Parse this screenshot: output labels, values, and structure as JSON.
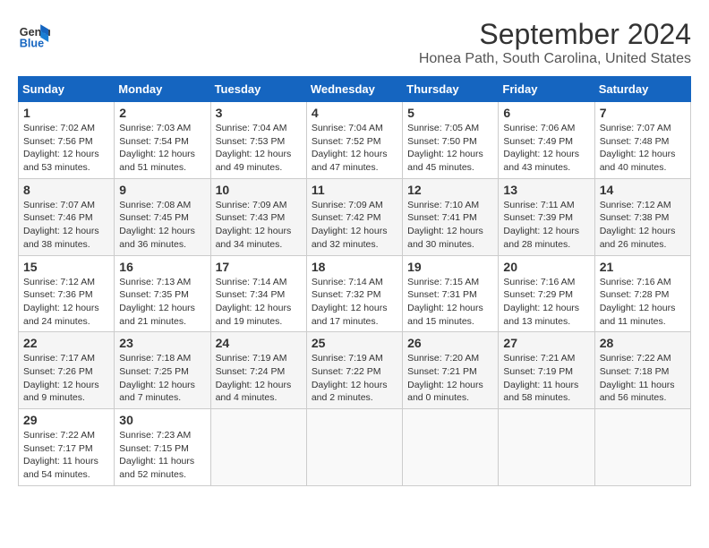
{
  "logo": {
    "line1": "General",
    "line2": "Blue"
  },
  "title": "September 2024",
  "subtitle": "Honea Path, South Carolina, United States",
  "weekdays": [
    "Sunday",
    "Monday",
    "Tuesday",
    "Wednesday",
    "Thursday",
    "Friday",
    "Saturday"
  ],
  "weeks": [
    [
      {
        "day": "1",
        "info": "Sunrise: 7:02 AM\nSunset: 7:56 PM\nDaylight: 12 hours\nand 53 minutes."
      },
      {
        "day": "2",
        "info": "Sunrise: 7:03 AM\nSunset: 7:54 PM\nDaylight: 12 hours\nand 51 minutes."
      },
      {
        "day": "3",
        "info": "Sunrise: 7:04 AM\nSunset: 7:53 PM\nDaylight: 12 hours\nand 49 minutes."
      },
      {
        "day": "4",
        "info": "Sunrise: 7:04 AM\nSunset: 7:52 PM\nDaylight: 12 hours\nand 47 minutes."
      },
      {
        "day": "5",
        "info": "Sunrise: 7:05 AM\nSunset: 7:50 PM\nDaylight: 12 hours\nand 45 minutes."
      },
      {
        "day": "6",
        "info": "Sunrise: 7:06 AM\nSunset: 7:49 PM\nDaylight: 12 hours\nand 43 minutes."
      },
      {
        "day": "7",
        "info": "Sunrise: 7:07 AM\nSunset: 7:48 PM\nDaylight: 12 hours\nand 40 minutes."
      }
    ],
    [
      {
        "day": "8",
        "info": "Sunrise: 7:07 AM\nSunset: 7:46 PM\nDaylight: 12 hours\nand 38 minutes."
      },
      {
        "day": "9",
        "info": "Sunrise: 7:08 AM\nSunset: 7:45 PM\nDaylight: 12 hours\nand 36 minutes."
      },
      {
        "day": "10",
        "info": "Sunrise: 7:09 AM\nSunset: 7:43 PM\nDaylight: 12 hours\nand 34 minutes."
      },
      {
        "day": "11",
        "info": "Sunrise: 7:09 AM\nSunset: 7:42 PM\nDaylight: 12 hours\nand 32 minutes."
      },
      {
        "day": "12",
        "info": "Sunrise: 7:10 AM\nSunset: 7:41 PM\nDaylight: 12 hours\nand 30 minutes."
      },
      {
        "day": "13",
        "info": "Sunrise: 7:11 AM\nSunset: 7:39 PM\nDaylight: 12 hours\nand 28 minutes."
      },
      {
        "day": "14",
        "info": "Sunrise: 7:12 AM\nSunset: 7:38 PM\nDaylight: 12 hours\nand 26 minutes."
      }
    ],
    [
      {
        "day": "15",
        "info": "Sunrise: 7:12 AM\nSunset: 7:36 PM\nDaylight: 12 hours\nand 24 minutes."
      },
      {
        "day": "16",
        "info": "Sunrise: 7:13 AM\nSunset: 7:35 PM\nDaylight: 12 hours\nand 21 minutes."
      },
      {
        "day": "17",
        "info": "Sunrise: 7:14 AM\nSunset: 7:34 PM\nDaylight: 12 hours\nand 19 minutes."
      },
      {
        "day": "18",
        "info": "Sunrise: 7:14 AM\nSunset: 7:32 PM\nDaylight: 12 hours\nand 17 minutes."
      },
      {
        "day": "19",
        "info": "Sunrise: 7:15 AM\nSunset: 7:31 PM\nDaylight: 12 hours\nand 15 minutes."
      },
      {
        "day": "20",
        "info": "Sunrise: 7:16 AM\nSunset: 7:29 PM\nDaylight: 12 hours\nand 13 minutes."
      },
      {
        "day": "21",
        "info": "Sunrise: 7:16 AM\nSunset: 7:28 PM\nDaylight: 12 hours\nand 11 minutes."
      }
    ],
    [
      {
        "day": "22",
        "info": "Sunrise: 7:17 AM\nSunset: 7:26 PM\nDaylight: 12 hours\nand 9 minutes."
      },
      {
        "day": "23",
        "info": "Sunrise: 7:18 AM\nSunset: 7:25 PM\nDaylight: 12 hours\nand 7 minutes."
      },
      {
        "day": "24",
        "info": "Sunrise: 7:19 AM\nSunset: 7:24 PM\nDaylight: 12 hours\nand 4 minutes."
      },
      {
        "day": "25",
        "info": "Sunrise: 7:19 AM\nSunset: 7:22 PM\nDaylight: 12 hours\nand 2 minutes."
      },
      {
        "day": "26",
        "info": "Sunrise: 7:20 AM\nSunset: 7:21 PM\nDaylight: 12 hours\nand 0 minutes."
      },
      {
        "day": "27",
        "info": "Sunrise: 7:21 AM\nSunset: 7:19 PM\nDaylight: 11 hours\nand 58 minutes."
      },
      {
        "day": "28",
        "info": "Sunrise: 7:22 AM\nSunset: 7:18 PM\nDaylight: 11 hours\nand 56 minutes."
      }
    ],
    [
      {
        "day": "29",
        "info": "Sunrise: 7:22 AM\nSunset: 7:17 PM\nDaylight: 11 hours\nand 54 minutes."
      },
      {
        "day": "30",
        "info": "Sunrise: 7:23 AM\nSunset: 7:15 PM\nDaylight: 11 hours\nand 52 minutes."
      },
      {
        "day": "",
        "info": ""
      },
      {
        "day": "",
        "info": ""
      },
      {
        "day": "",
        "info": ""
      },
      {
        "day": "",
        "info": ""
      },
      {
        "day": "",
        "info": ""
      }
    ]
  ]
}
